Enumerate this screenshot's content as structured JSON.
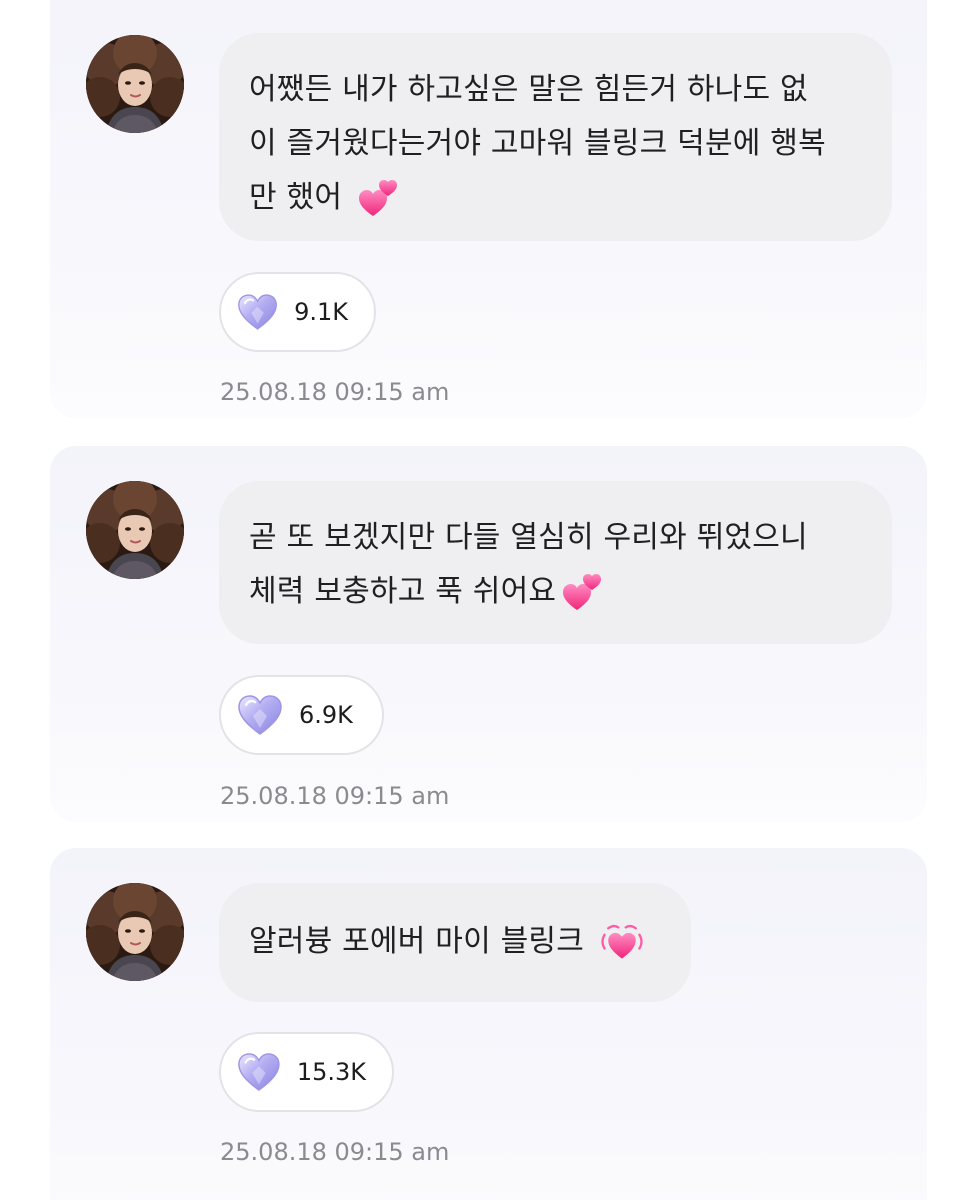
{
  "messages": [
    {
      "text": "어쨌든 내가 하고싶은 말은 힘든거 하나도 없\n이 즐거웠다는거야 고마워 블링크 덕분에 행복\n만 했어 ",
      "emoji": "two-hearts-icon",
      "likes": "9.1K",
      "timestamp": "25.08.18 09:15 am"
    },
    {
      "text": "곧 또 보겠지만 다들 열심히 우리와 뛰었으니\n체력 보충하고 푹 쉬어요",
      "emoji": "two-hearts-icon",
      "likes": "6.9K",
      "timestamp": "25.08.18 09:15 am"
    },
    {
      "text": "알러븅 포에버 마이 블링크 ",
      "emoji": "beating-heart-icon",
      "likes": "15.3K",
      "timestamp": "25.08.18 09:15 am"
    }
  ],
  "colors": {
    "card_bg": "#f3f3fa",
    "bubble_bg": "#efeff1",
    "timestamp": "#8a8a90",
    "heart_like": "#b9b4f0",
    "heart_emoji": "#ff4f9a"
  }
}
